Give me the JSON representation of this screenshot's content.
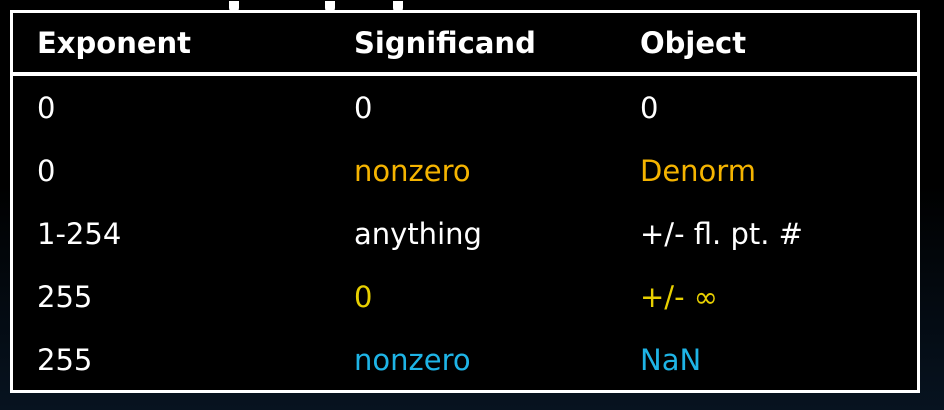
{
  "colors": {
    "default": "#ffffff",
    "orange": "#f5b400",
    "yellow": "#e8d000",
    "blue": "#1eb4e6"
  },
  "table": {
    "headers": [
      "Exponent",
      "Significand",
      "Object"
    ],
    "rows": [
      {
        "cells": [
          "0",
          "0",
          "0"
        ],
        "colors": [
          "default",
          "default",
          "default"
        ]
      },
      {
        "cells": [
          "0",
          "nonzero",
          "Denorm"
        ],
        "colors": [
          "default",
          "orange",
          "orange"
        ]
      },
      {
        "cells": [
          "1-254",
          "anything",
          "+/- fl. pt. #"
        ],
        "colors": [
          "default",
          "default",
          "default"
        ]
      },
      {
        "cells": [
          "255",
          "0",
          "+/- ∞"
        ],
        "colors": [
          "default",
          "yellow",
          "yellow"
        ]
      },
      {
        "cells": [
          "255",
          "nonzero",
          "NaN"
        ],
        "colors": [
          "default",
          "blue",
          "blue"
        ]
      }
    ]
  }
}
